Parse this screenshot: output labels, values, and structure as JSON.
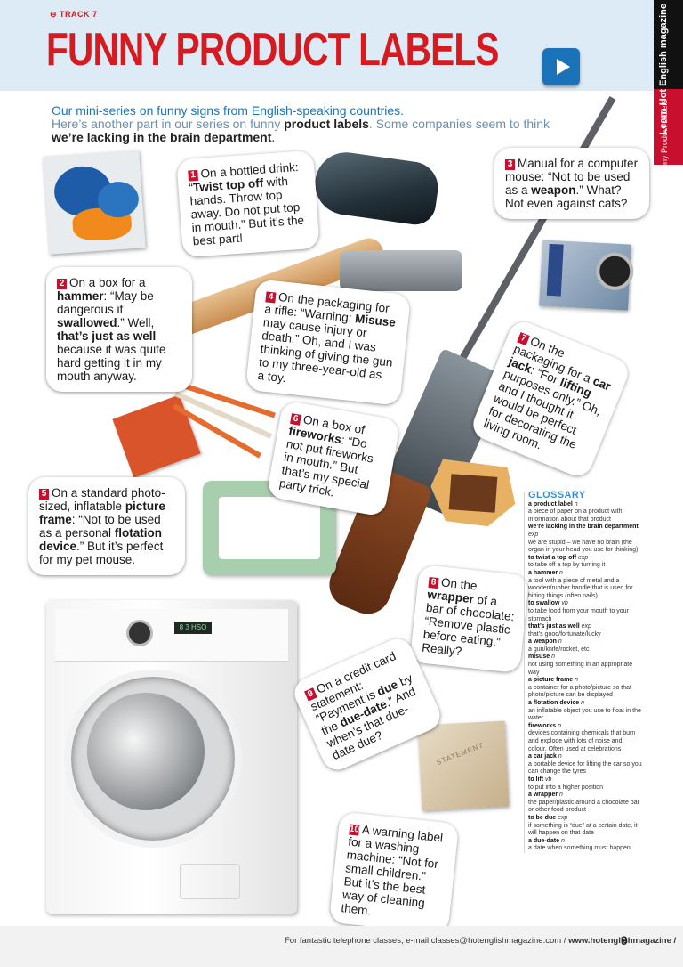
{
  "header": {
    "track": "⊖ TRACK 7",
    "title": "FUNNY PRODUCT LABELS",
    "play_icon": "play-icon"
  },
  "side_tab": {
    "brand": "Learn Hot English magazine",
    "section": "Funny Product Labels"
  },
  "intro": {
    "line1": "Our mini-series on funny signs from English-speaking countries.",
    "line2_a": "Here’s another part in our series on funny ",
    "line2_b": "product labels",
    "line2_c": ". Some companies seem to think",
    "line3": "we’re lacking in the brain department",
    "line3_end": "."
  },
  "labels": [
    {
      "n": "1",
      "a": "On a bottled drink: “",
      "b": "Twist top off",
      "c": " with hands. Throw top away. Do not put top in mouth.” But it’s the best part!"
    },
    {
      "n": "2",
      "a": "On a box for a ",
      "b": "hammer",
      "c": ": “May be dangerous if ",
      "d": "swallowed",
      "e": ".” Well, ",
      "f": "that’s just as well",
      "g": " because it was quite hard getting it in my mouth anyway."
    },
    {
      "n": "3",
      "a": "Manual for a computer mouse: “Not to be used as a ",
      "b": "weapon",
      "c": ".” What? Not even against cats?"
    },
    {
      "n": "4",
      "a": "On the packaging for a rifle: “Warning: ",
      "b": "Misuse",
      "c": " may cause injury or death.” Oh, and I was thinking of giving the gun to my three-year-old as a toy."
    },
    {
      "n": "5",
      "a": "On a standard photo-sized, inflatable ",
      "b": "picture frame",
      "c": ": “Not to be used as a personal ",
      "d": "flotation device",
      "e": ".” But it’s perfect for my pet mouse."
    },
    {
      "n": "6",
      "a": "On a box of ",
      "b": "fireworks",
      "c": ": “Do not put fireworks in mouth.” But that’s my special party trick."
    },
    {
      "n": "7",
      "a": "On the packaging for a ",
      "b": "car jack",
      "c": ": “For ",
      "d": "lifting",
      "e": " purposes only.” Oh, and I thought it would be perfect for decorating the living room."
    },
    {
      "n": "8",
      "a": "On the ",
      "b": "wrapper",
      "c": " of a bar of chocolate: “Remove plastic before eating.” Really?"
    },
    {
      "n": "9",
      "a": "On a credit card statement: “Payment is ",
      "b": "due",
      "c": " by the ",
      "d": "due-date",
      "e": ".” And when’s that due-date due?"
    },
    {
      "n": "10",
      "a": "A warning label for a washing machine: “Not for small children.” But it’s the best way of cleaning them."
    }
  ],
  "glossary": {
    "title": "GLOSSARY",
    "entries": [
      {
        "term": "a product label",
        "pos": " n",
        "def": "a piece of paper on a product with information about that product"
      },
      {
        "term": "we’re lacking in the brain department",
        "pos": " exp",
        "def": "we are stupid – we have no brain (the organ in your head you use for thinking)"
      },
      {
        "term": "to twist a top off",
        "pos": " exp",
        "def": "to take off a top by turning it"
      },
      {
        "term": "a hammer",
        "pos": " n",
        "def": "a tool with a piece of metal and a wooden/rubber handle that is used for hitting things (often nails)"
      },
      {
        "term": "to swallow",
        "pos": " vb",
        "def": "to take food from your mouth to your stomach"
      },
      {
        "term": "that’s just as well",
        "pos": " exp",
        "def": "that’s good/fortunate/lucky"
      },
      {
        "term": "a weapon",
        "pos": " n",
        "def": "a gun/knife/rocket, etc"
      },
      {
        "term": "misuse",
        "pos": " n",
        "def": "not using something in an appropriate way"
      },
      {
        "term": "a picture frame",
        "pos": " n",
        "def": "a container for a photo/picture so that photo/picture can be displayed"
      },
      {
        "term": "a flotation device",
        "pos": " n",
        "def": "an inflatable object you use to float in the water"
      },
      {
        "term": "fireworks",
        "pos": " n",
        "def": "devices containing chemicals that burn and explode with lots of noise and colour. Often used at celebrations"
      },
      {
        "term": "a car jack",
        "pos": " n",
        "def": "a portable device for lifting the car so you can change the tyres"
      },
      {
        "term": "to lift",
        "pos": " vb",
        "def": "to put into a higher position"
      },
      {
        "term": "a wrapper",
        "pos": " n",
        "def": "the paper/plastic around a chocolate bar or other food product"
      },
      {
        "term": "to be due",
        "pos": " exp",
        "def": "if something is “due” at a certain date, it will happen on that date"
      },
      {
        "term": "a due-date",
        "pos": " n",
        "def": "a date when something must happen"
      }
    ]
  },
  "footer": {
    "text": "For fantastic telephone classes, e-mail classes@hotenglishmagazine.com / ",
    "url": "www.hotenglishmagazine / ",
    "page": "9"
  },
  "colors": {
    "accent_red": "#d71920",
    "accent_blue": "#1b74bb",
    "header_band": "#dcebf5"
  },
  "icons": [
    "play-icon",
    "bottle-tops-photo",
    "computer-mouse-photo",
    "hammer-photo",
    "rifle-photo",
    "car-jack-photo",
    "fireworks-photo",
    "picture-frame-photo",
    "chocolate-photo",
    "statement-photo",
    "washing-machine-photo"
  ]
}
